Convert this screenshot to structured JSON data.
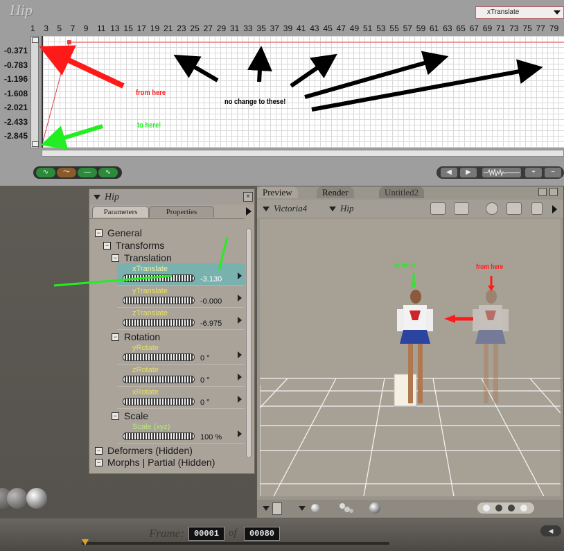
{
  "graph": {
    "title": "Hip",
    "parameter_select": "xTranslate",
    "frame_ticks": [
      "1",
      "3",
      "5",
      "7",
      "9",
      "11",
      "13",
      "15",
      "17",
      "19",
      "21",
      "23",
      "25",
      "27",
      "29",
      "31",
      "33",
      "35",
      "37",
      "39",
      "41",
      "43",
      "45",
      "47",
      "49",
      "51",
      "53",
      "55",
      "57",
      "59",
      "61",
      "63",
      "65",
      "67",
      "69",
      "71",
      "73",
      "75",
      "77",
      "79"
    ],
    "value_ticks": [
      "-0.371",
      "-0.783",
      "-1.196",
      "-1.608",
      "-2.021",
      "-2.433",
      "-2.845"
    ],
    "curve_buttons": [
      "∿",
      "〜",
      "—",
      "∿"
    ],
    "play_buttons": [
      "◀",
      "▶",
      "+",
      "−"
    ],
    "annotations": {
      "from_here": "from here",
      "to_here": "to here!",
      "no_change": "no change to these!"
    }
  },
  "parameters_panel": {
    "title": "Hip",
    "close_glyph": "×",
    "tabs": [
      "Parameters",
      "Properties"
    ],
    "groups": {
      "general": "General",
      "transforms": "Transforms",
      "translation": "Translation",
      "rotation": "Rotation",
      "scale": "Scale",
      "deformers": "Deformers (Hidden)",
      "morphs": "Morphs | Partial (Hidden)"
    },
    "expand_glyph": "−",
    "rows": [
      {
        "label": "xTranslate",
        "value": "-3.130",
        "selected": true
      },
      {
        "label": "yTranslate",
        "value": "-0.000"
      },
      {
        "label": "zTranslate",
        "value": "-6.975"
      },
      {
        "label": "yRotate",
        "value": "0 °"
      },
      {
        "label": "zRotate",
        "value": "0 °"
      },
      {
        "label": "xRotate",
        "value": "0 °"
      },
      {
        "label": "Scale (xyz)",
        "value": "100 %"
      }
    ]
  },
  "preview": {
    "tabs": [
      "Preview",
      "Render",
      "Untitled2"
    ],
    "figure_select": "Victoria4",
    "actor_select": "Hip",
    "annotations": {
      "to_here": "to here!",
      "from_here": "from here"
    }
  },
  "timeline": {
    "frame_label": "Frame:",
    "current_frame": "00001",
    "of_label": "of",
    "total_frames": "00080"
  },
  "colors": {
    "annot_red": "#ff1a1a",
    "annot_green": "#22ee22",
    "annot_black": "#000000",
    "selected_row": "#79b1ae",
    "param_label": "#e8e060"
  }
}
